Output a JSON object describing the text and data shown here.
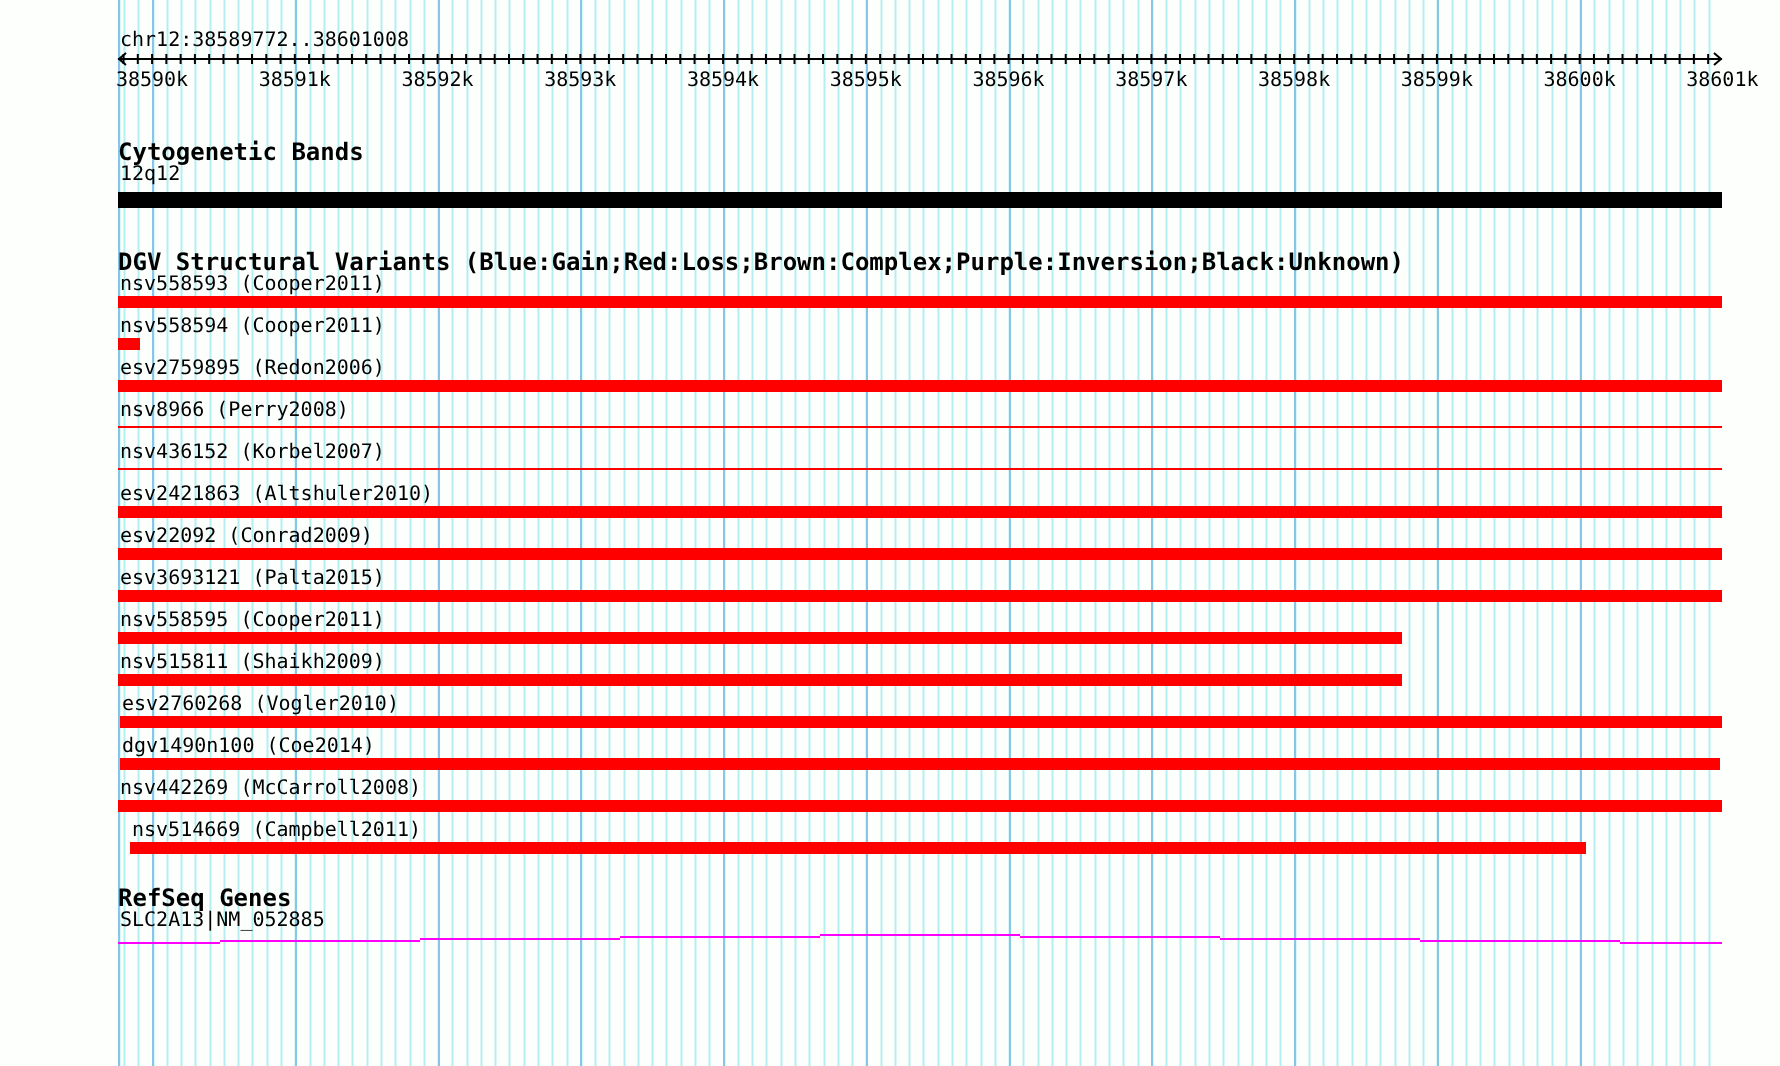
{
  "ruler": {
    "position": "chr12:38589772..38601008",
    "ticks": [
      "38590k",
      "38591k",
      "38592k",
      "38593k",
      "38594k",
      "38595k",
      "38596k",
      "38597k",
      "38598k",
      "38599k",
      "38600k",
      "38601k"
    ]
  },
  "cytogenetic_bands": {
    "title": "Cytogenetic Bands",
    "bands": [
      {
        "label": "12q12"
      }
    ]
  },
  "dgv": {
    "title": "DGV Structural Variants (Blue:Gain;Red:Loss;Brown:Complex;Purple:Inversion;Black:Unknown)",
    "variants": [
      {
        "label": "nsv558593 (Cooper2011)",
        "kind": "bar",
        "color": "#ff0000"
      },
      {
        "label": "nsv558594 (Cooper2011)",
        "kind": "bar",
        "color": "#ff0000"
      },
      {
        "label": "esv2759895 (Redon2006)",
        "kind": "bar",
        "color": "#ff0000"
      },
      {
        "label": "nsv8966 (Perry2008)",
        "kind": "line",
        "color": "#ff0000"
      },
      {
        "label": "nsv436152 (Korbel2007)",
        "kind": "line",
        "color": "#ff0000"
      },
      {
        "label": "esv2421863 (Altshuler2010)",
        "kind": "bar",
        "color": "#ff0000"
      },
      {
        "label": "esv22092 (Conrad2009)",
        "kind": "bar",
        "color": "#ff0000"
      },
      {
        "label": "esv3693121 (Palta2015)",
        "kind": "bar",
        "color": "#ff0000"
      },
      {
        "label": "nsv558595 (Cooper2011)",
        "kind": "bar",
        "color": "#ff0000"
      },
      {
        "label": "nsv515811 (Shaikh2009)",
        "kind": "bar",
        "color": "#ff0000"
      },
      {
        "label": "esv2760268 (Vogler2010)",
        "kind": "bar",
        "color": "#ff0000"
      },
      {
        "label": "dgv1490n100 (Coe2014)",
        "kind": "bar",
        "color": "#ff0000"
      },
      {
        "label": "nsv442269 (McCarroll2008)",
        "kind": "bar",
        "color": "#ff0000"
      },
      {
        "label": "nsv514669 (Campbell2011)",
        "kind": "bar",
        "color": "#ff0000"
      }
    ]
  },
  "refseq": {
    "title": "RefSeq Genes",
    "genes": [
      {
        "label": "SLC2A13|NM_052885"
      }
    ]
  }
}
